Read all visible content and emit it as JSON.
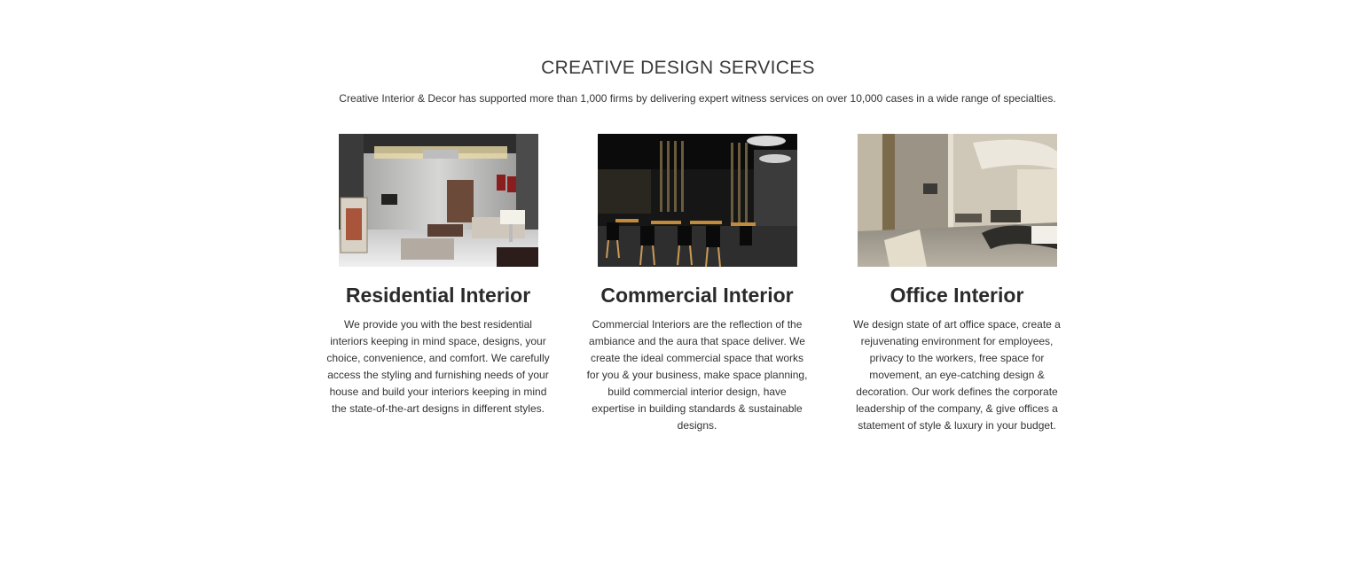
{
  "section": {
    "title": "CREATIVE DESIGN SERVICES",
    "subtitle": "Creative Interior & Decor has supported more than 1,000 firms by delivering expert witness services on over 10,000 cases in a wide range of specialties."
  },
  "cards": [
    {
      "title": "Residential Interior",
      "text": "We provide you with the best residential interiors keeping in mind space, designs, your choice, convenience, and comfort. We carefully access the styling and furnishing needs of your house and build your interiors keeping in mind the state-of-the-art designs in different styles.",
      "image": "residential-living-room-photo"
    },
    {
      "title": "Commercial Interior",
      "text": "Commercial Interiors are the reflection of the ambiance and the aura that space deliver.  We create the ideal commercial space that works for you & your business, make space planning, build commercial interior design, have expertise in building standards & sustainable designs.",
      "image": "commercial-restaurant-photo"
    },
    {
      "title": "Office Interior",
      "text": "We design state of art office space, create a rejuvenating environment for employees, privacy to the workers, free space for movement, an eye-catching design & decoration. Our work defines the corporate leadership of the company, & give offices a statement of style & luxury in your budget.",
      "image": "office-reception-photo"
    }
  ]
}
